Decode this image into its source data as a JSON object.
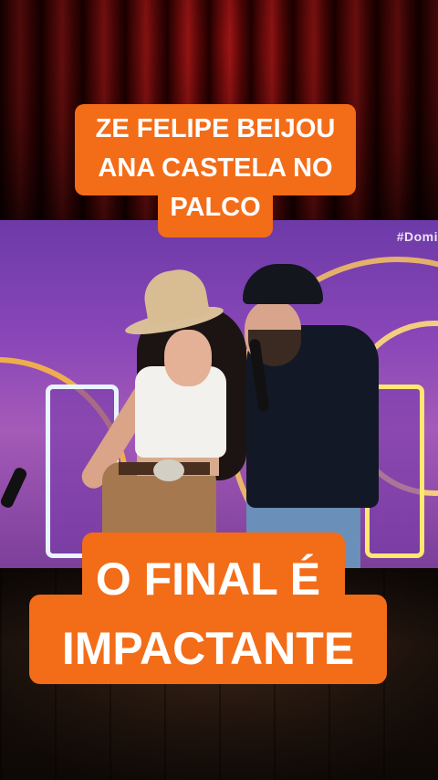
{
  "video": {
    "channel_tag": "#Domi"
  },
  "captions": {
    "top": "ZE FELIPE BEIJOU\nANA CASTELA NO\nPALCO",
    "bottom": "O FINAL É\nIMPACTANTE"
  },
  "colors": {
    "caption_bg": "#f36c18",
    "caption_text": "#ffffff"
  }
}
